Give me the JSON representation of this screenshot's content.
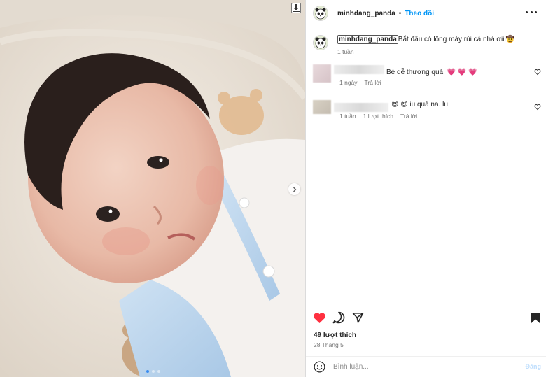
{
  "post": {
    "username": "minhdang_panda",
    "separator": "•",
    "follow_label": "Theo dõi",
    "caption": {
      "username": "minhdang_panda",
      "text": "Bắt đầu có lông mày rùi cả nhà ơiii🤠",
      "age": "1 tuần"
    },
    "comments": [
      {
        "text": "Bé dễ thương quá! 💗 💗 💗",
        "meta": [
          "1 ngày",
          "Trả lời"
        ]
      },
      {
        "text": "😍 😍 iu quá na. lu",
        "meta": [
          "1 tuần",
          "1 lượt thích",
          "Trả lời"
        ]
      }
    ],
    "likes": "49 lượt thích",
    "date": "28 Tháng 5",
    "comment_placeholder": "Bình luận...",
    "post_label": "Đăng",
    "carousel": {
      "count": 3,
      "active_index": 0
    }
  },
  "icons": {
    "download": "download-icon",
    "next": "chevron-right-icon",
    "more": "more-options-icon",
    "heart": "heart-filled-icon",
    "comment": "comment-icon",
    "share": "share-icon",
    "save": "bookmark-filled-icon",
    "emoji": "emoji-icon"
  },
  "colors": {
    "follow": "#0095f6",
    "like_heart": "#ff3040",
    "carousel_active": "#3a8cf0",
    "post_disabled": "#c0dffd"
  }
}
